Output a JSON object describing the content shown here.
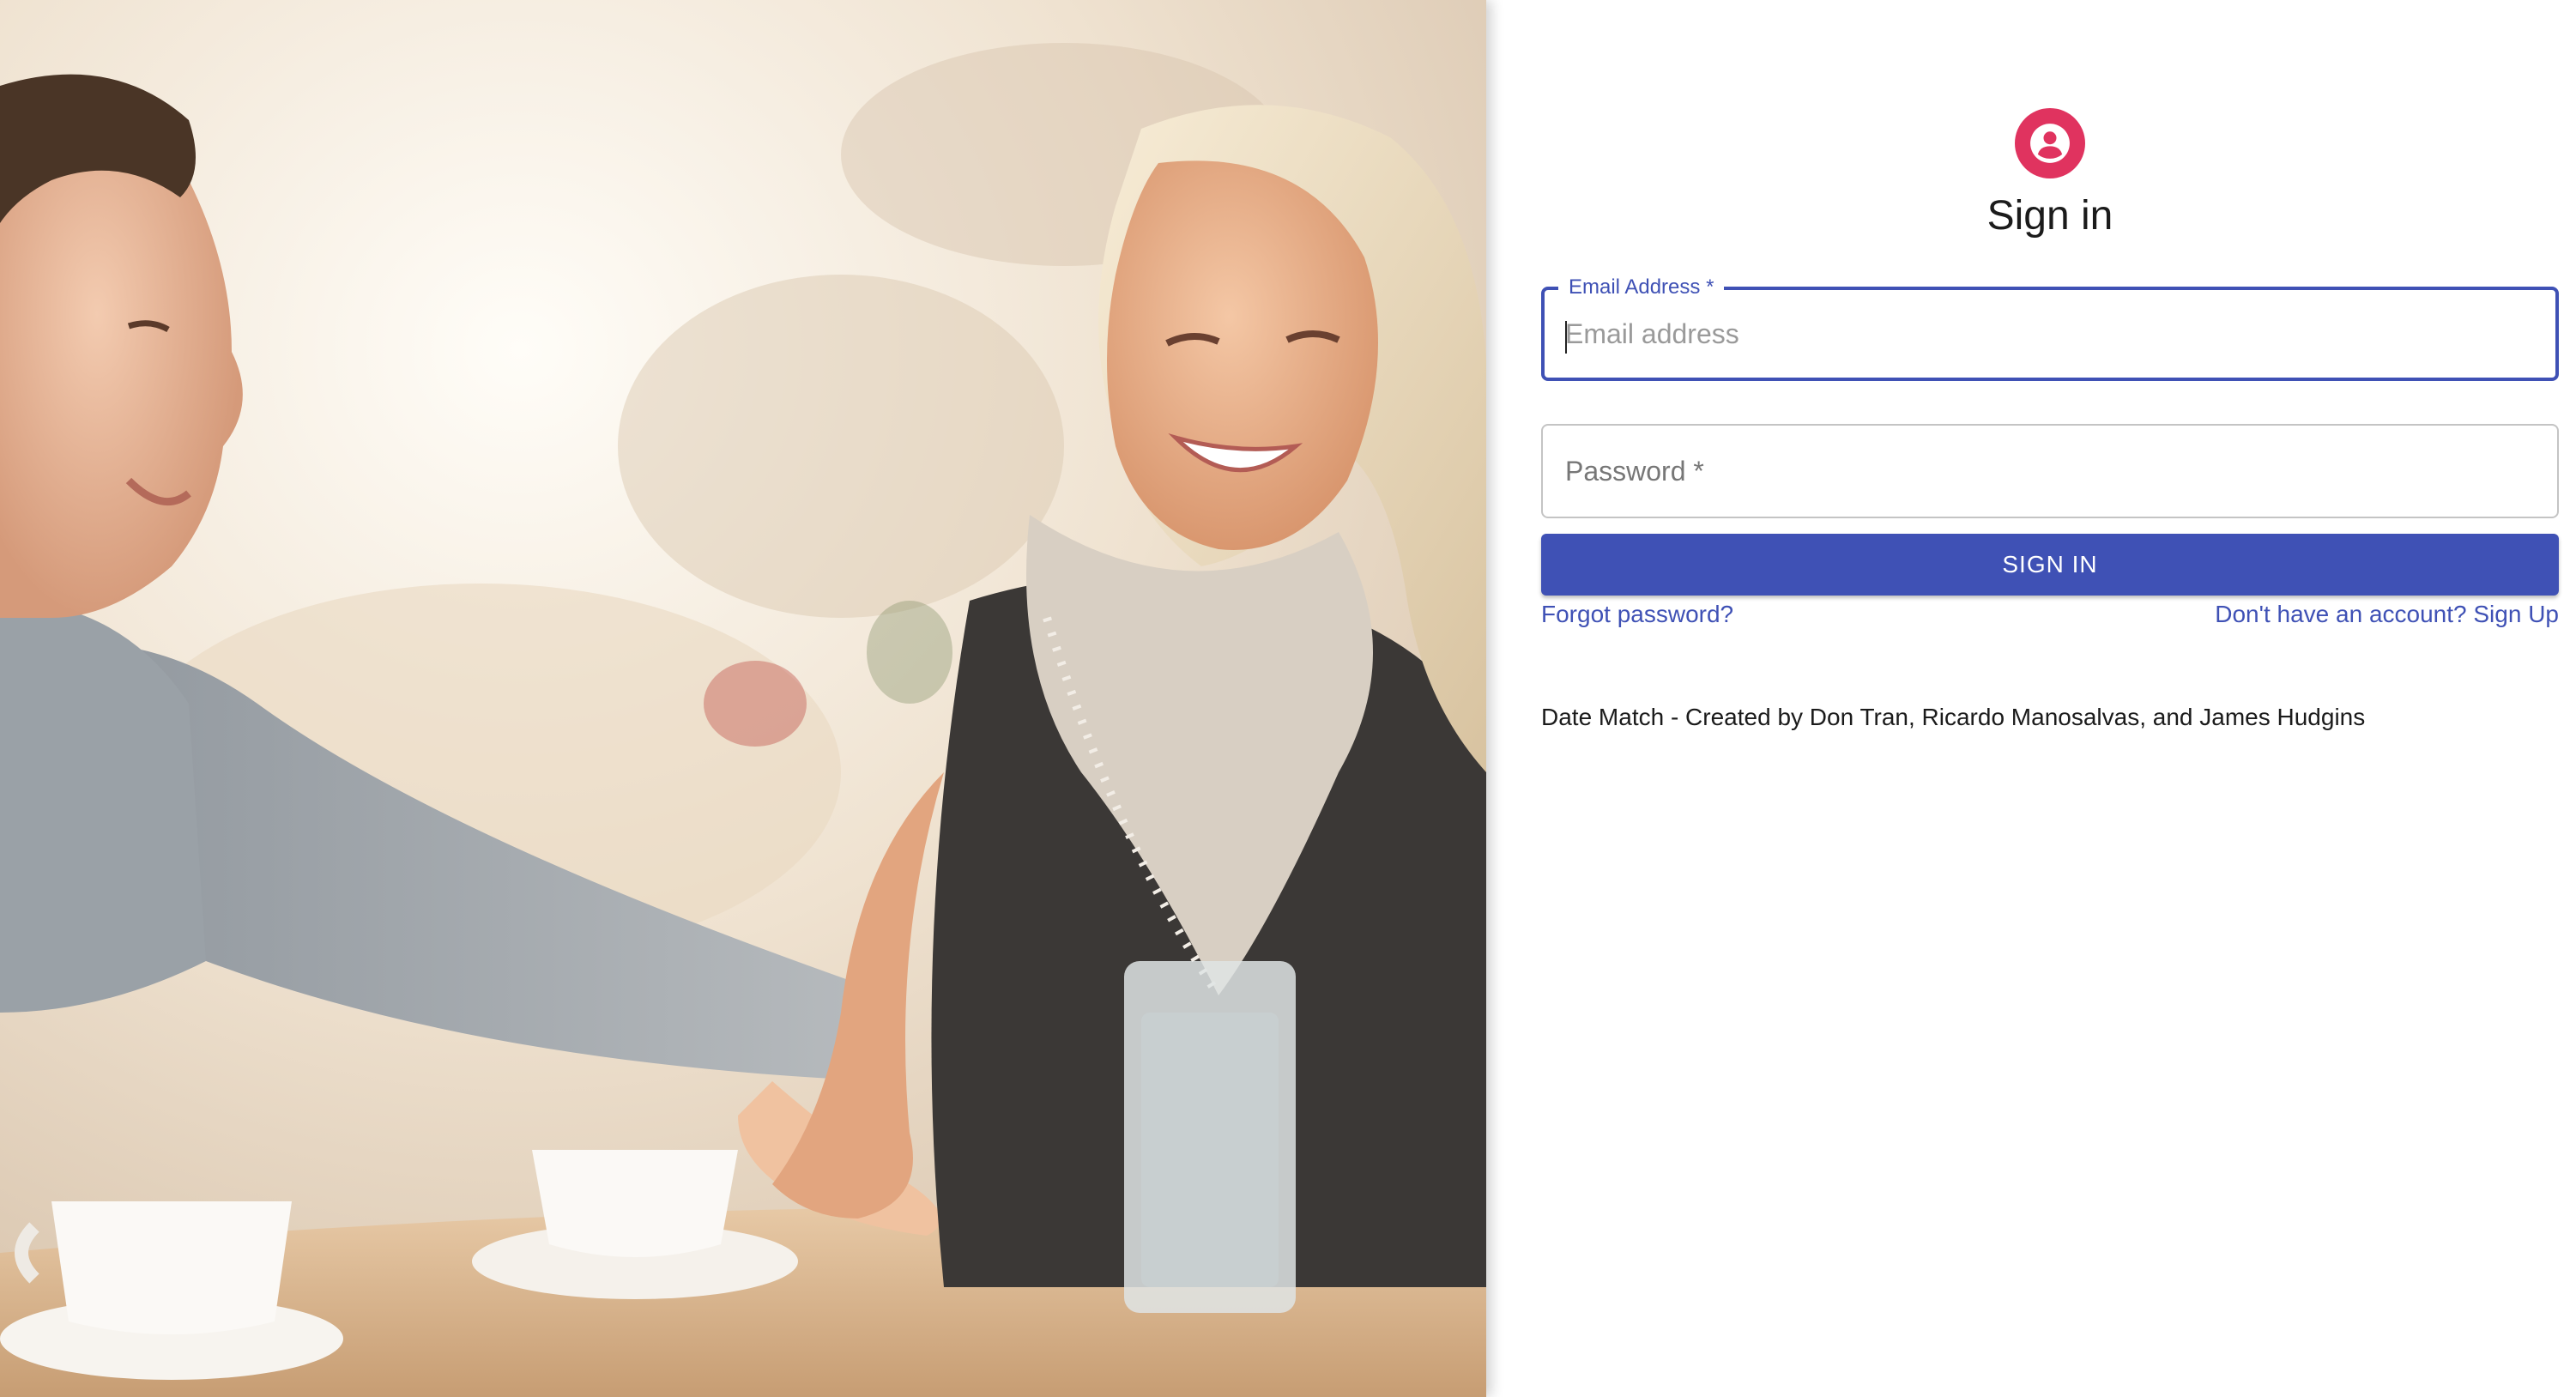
{
  "hero": {
    "icon": "couple-cafe-photo"
  },
  "colors": {
    "primary": "#3f51b5",
    "avatar": "#e0335f"
  },
  "signin": {
    "avatar_icon": "person-icon",
    "title": "Sign in",
    "email": {
      "label": "Email Address *",
      "placeholder": "Email address",
      "value": ""
    },
    "password": {
      "label": "Password *",
      "value": ""
    },
    "submit_label": "SIGN IN",
    "forgot_link": "Forgot password?",
    "signup_link": "Don't have an account? Sign Up"
  },
  "footer": {
    "credits": "Date Match - Created by Don Tran, Ricardo Manosalvas, and James Hudgins"
  }
}
